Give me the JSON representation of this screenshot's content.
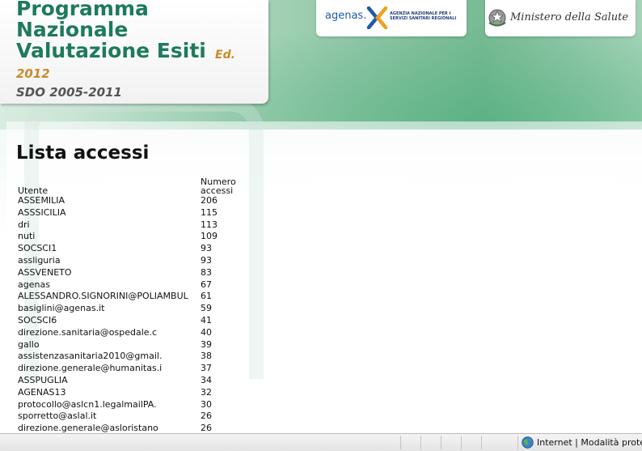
{
  "header": {
    "title_lines": [
      "Programma",
      "Nazionale",
      "Valutazione Esiti"
    ],
    "edition_label": "Ed.",
    "edition_year": "2012",
    "period": "SDO 2005-2011",
    "agenas_logo": {
      "wordmark": "agenas.",
      "tagline": "AGENZIA NAZIONALE PER I SERVIZI SANITARI REGIONALI"
    },
    "ministero_logo": {
      "text": "Ministero della Salute"
    }
  },
  "main": {
    "page_title": "Lista accessi",
    "table": {
      "columns": [
        "Utente",
        "Numero accessi"
      ],
      "rows": [
        {
          "user": "ASSEMILIA",
          "count": "206"
        },
        {
          "user": "ASSSICILIA",
          "count": "115"
        },
        {
          "user": "dri",
          "count": "113"
        },
        {
          "user": "nuti",
          "count": "109"
        },
        {
          "user": "SOCSCI1",
          "count": "93"
        },
        {
          "user": "assliguria",
          "count": "93"
        },
        {
          "user": "ASSVENETO",
          "count": "83"
        },
        {
          "user": "agenas",
          "count": "67"
        },
        {
          "user": "ALESSANDRO.SIGNORINI@POLIAMBUL",
          "count": "61"
        },
        {
          "user": "basiglini@agenas.it",
          "count": "59"
        },
        {
          "user": "SOCSCI6",
          "count": "41"
        },
        {
          "user": "direzione.sanitaria@ospedale.c",
          "count": "40"
        },
        {
          "user": "gallo",
          "count": "39"
        },
        {
          "user": "assistenzasanitaria2010@gmail.",
          "count": "38"
        },
        {
          "user": "direzione.generale@humanitas.i",
          "count": "37"
        },
        {
          "user": "ASSPUGLIA",
          "count": "34"
        },
        {
          "user": "AGENAS13",
          "count": "32"
        },
        {
          "user": "protocollo@aslcn1.legalmailPA.",
          "count": "30"
        },
        {
          "user": "sporretto@aslal.it",
          "count": "26"
        },
        {
          "user": "direzione.generale@asloristano",
          "count": "26"
        }
      ]
    }
  },
  "status_bar": {
    "zone_text": "Internet | Modalità prote",
    "zone_icon": "globe-icon"
  },
  "colors": {
    "title_green": "#1e7a5c",
    "edition_orange": "#c88a2a",
    "agenas_blue": "#1f5aa8"
  }
}
